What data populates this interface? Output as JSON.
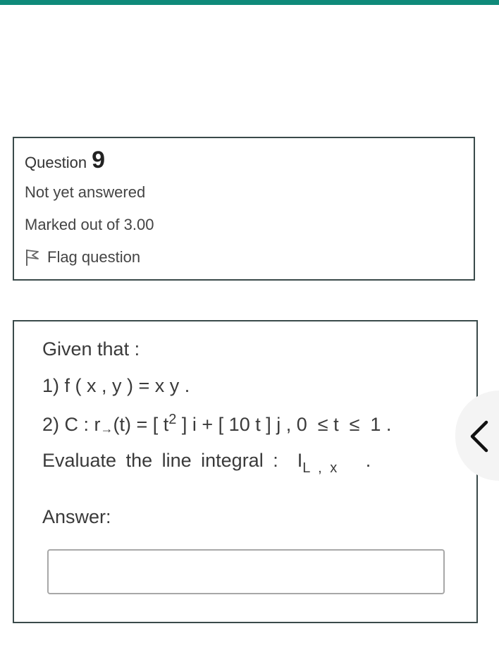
{
  "question": {
    "word": "Question",
    "number": "9",
    "state": "Not yet answered",
    "mark": "Marked out of 3.00",
    "flag_label": "Flag question"
  },
  "content": {
    "given": "Given that :",
    "line1": "1) f ( x , y ) = x y .",
    "line2_prefix": "2) C : r",
    "line2_arrow": "→",
    "line2_mid": "(t) = [ t",
    "line2_exp": "2",
    "line2_suffix": " ] i + [ 10 t ] j , 0  ≤ t  ≤  1 .",
    "eval_prefix": "Evaluate the line integral :  I",
    "eval_sub": "L , x",
    "eval_suffix": "   .",
    "answer_label": "Answer:",
    "answer_value": ""
  },
  "icons": {
    "flag": "flag-icon",
    "drawer": "chevron-left-icon"
  },
  "colors": {
    "accent": "#0f8a7a",
    "border": "#3a4a4a"
  }
}
